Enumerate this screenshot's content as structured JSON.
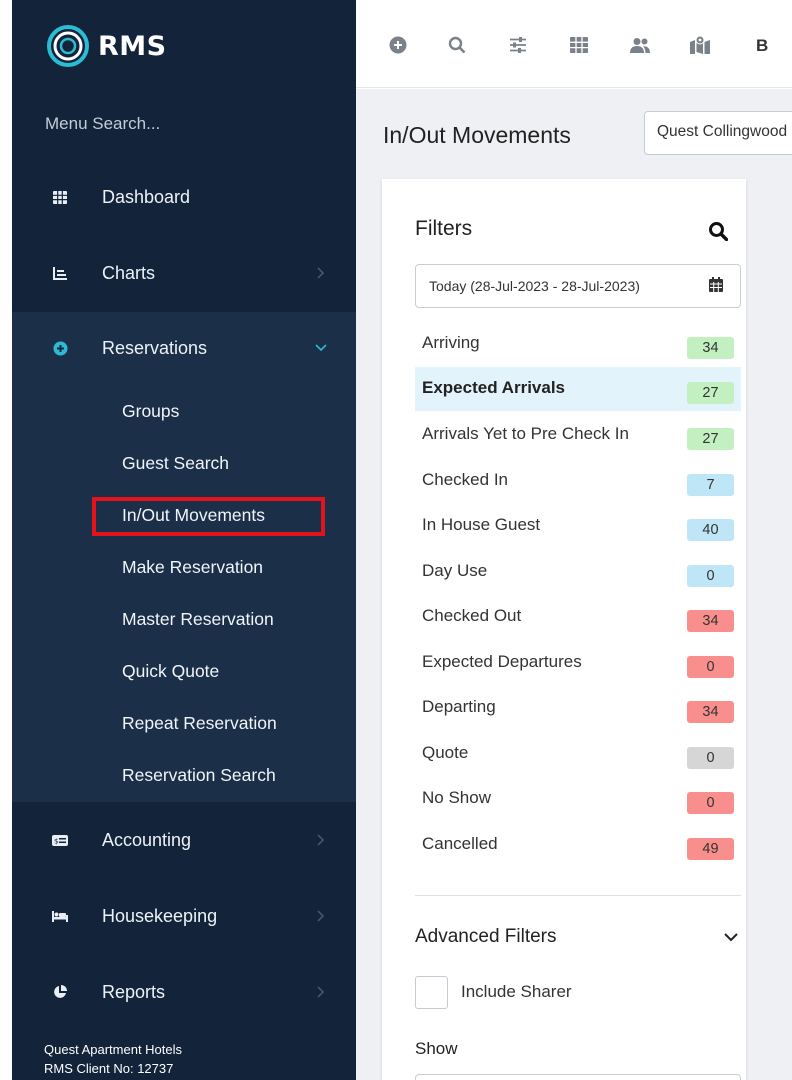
{
  "brand": {
    "name": "RMS"
  },
  "sidebar": {
    "menu_search_placeholder": "Menu Search...",
    "items": [
      {
        "label": "Dashboard",
        "icon": "table-icon"
      },
      {
        "label": "Charts",
        "icon": "bar-chart-icon"
      },
      {
        "label": "Reservations",
        "icon": "plus-circle-icon"
      },
      {
        "label": "Accounting",
        "icon": "money-icon"
      },
      {
        "label": "Housekeeping",
        "icon": "bed-icon"
      },
      {
        "label": "Reports",
        "icon": "pie-chart-icon"
      }
    ],
    "reservations_subitems": [
      {
        "label": "Groups"
      },
      {
        "label": "Guest Search"
      },
      {
        "label": "In/Out Movements"
      },
      {
        "label": "Make Reservation"
      },
      {
        "label": "Master Reservation"
      },
      {
        "label": "Quick Quote"
      },
      {
        "label": "Repeat Reservation"
      },
      {
        "label": "Reservation Search"
      }
    ],
    "footer": {
      "company": "Quest Apartment Hotels",
      "client_no": "RMS Client No: 12737"
    }
  },
  "toolbar": {
    "icons": [
      "plus-circle-icon",
      "search-icon",
      "sliders-icon",
      "grid-icon",
      "users-icon",
      "map-icon"
    ],
    "trailing_letter": "B"
  },
  "main": {
    "title": "In/Out Movements",
    "property_select_value": "Quest Collingwood"
  },
  "filters": {
    "title": "Filters",
    "date_range": "Today (28-Jul-2023 - 28-Jul-2023)",
    "rows": [
      {
        "label": "Arriving",
        "count": "34",
        "status": "green"
      },
      {
        "label": "Expected Arrivals",
        "count": "27",
        "status": "green"
      },
      {
        "label": "Arrivals Yet to Pre Check In",
        "count": "27",
        "status": "green"
      },
      {
        "label": "Checked In",
        "count": "7",
        "status": "blue"
      },
      {
        "label": "In House Guest",
        "count": "40",
        "status": "blue"
      },
      {
        "label": "Day Use",
        "count": "0",
        "status": "blue"
      },
      {
        "label": "Checked Out",
        "count": "34",
        "status": "red"
      },
      {
        "label": "Expected Departures",
        "count": "0",
        "status": "red"
      },
      {
        "label": "Departing",
        "count": "34",
        "status": "red"
      },
      {
        "label": "Quote",
        "count": "0",
        "status": "grey"
      },
      {
        "label": "No Show",
        "count": "0",
        "status": "red"
      },
      {
        "label": "Cancelled",
        "count": "49",
        "status": "red"
      }
    ],
    "advanced_title": "Advanced Filters",
    "include_sharer_label": "Include Sharer",
    "show_label": "Show"
  },
  "colors": {
    "sidebar_bg": "#12233a",
    "sidebar_expanded_bg": "#1b2f49",
    "accent_teal": "#2bbcd4",
    "highlight_red": "#e3131b",
    "active_row_bg": "#e3f3fb"
  }
}
